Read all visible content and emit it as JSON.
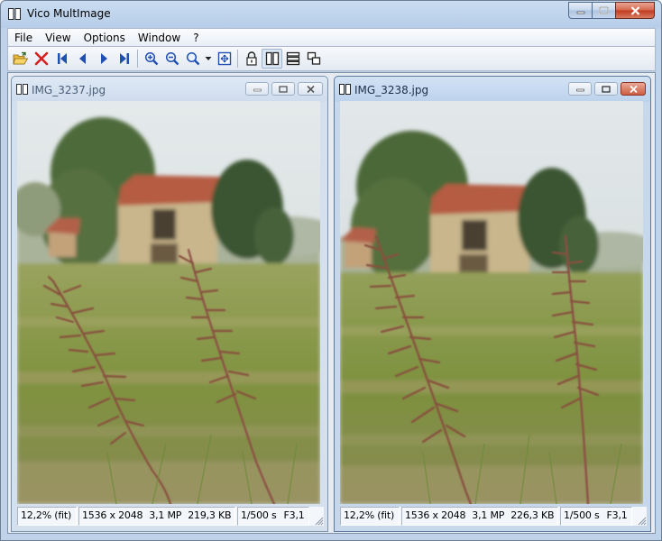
{
  "app": {
    "title": "Vico MultImage",
    "menu": [
      "File",
      "View",
      "Options",
      "Window",
      "?"
    ]
  },
  "toolbar": {
    "icons": [
      "open-folder-icon",
      "close-x-icon",
      "first-image-icon",
      "previous-image-icon",
      "next-image-icon",
      "last-image-icon",
      "zoom-in-icon",
      "zoom-out-icon",
      "zoom-menu-icon",
      "fit-to-window-icon",
      "lock-icon",
      "tile-vertical-icon",
      "tile-horizontal-icon",
      "cascade-icon"
    ]
  },
  "windows": [
    {
      "title": "IMG_3237.jpg",
      "status": {
        "zoom": "12,2% (fit)",
        "dimensions": "1536 x 2048",
        "megapixels": "3,1 MP",
        "filesize": "219,3 KB",
        "shutter": "1/500 s",
        "aperture": "F3,1"
      }
    },
    {
      "title": "IMG_3238.jpg",
      "status": {
        "zoom": "12,2% (fit)",
        "dimensions": "1536 x 2048",
        "megapixels": "3,1 MP",
        "filesize": "226,3 KB",
        "shutter": "1/500 s",
        "aperture": "F3,1"
      }
    }
  ],
  "colors": {
    "sky": "#dfe5e6",
    "grass": "#8a9a4f",
    "roof": "#b5654a",
    "wall": "#c8b48a",
    "tree": "#3f5a32",
    "grass_stalk": "#8a4d46"
  }
}
